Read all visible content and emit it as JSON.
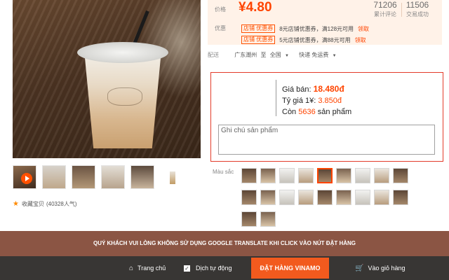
{
  "gallery": {
    "favorite_icon": "star-icon",
    "favorite_label": "收藏宝贝",
    "favorite_count": "(40328人气)"
  },
  "price_panel": {
    "price_label": "价格",
    "price": "¥4.80",
    "reviews_count": "71206",
    "reviews_label": "累计评论",
    "sales_count": "11506",
    "sales_label": "交易成功",
    "promo_label": "优惠",
    "coupons": [
      {
        "tag": "店铺 优惠券",
        "text": "8元店铺优惠券，满128元可用",
        "claim": "领取"
      },
      {
        "tag": "店铺 优惠券",
        "text": "5元店铺优惠券，满88元可用",
        "claim": "领取"
      }
    ]
  },
  "shipping": {
    "label": "配送",
    "from": "广东潮州",
    "to_word": "至",
    "to": "全国",
    "method": "快递 免运费"
  },
  "vn_info": {
    "price_label": "Giá bán:",
    "price_value": "18.480đ",
    "rate_label": "Tỷ giá 1¥:",
    "rate_value": "3.850đ",
    "stock_prefix": "Còn",
    "stock_value": "5636",
    "stock_suffix": "sản phẩm",
    "note_placeholder": "Ghi chú sản phẩm"
  },
  "colors": {
    "label": "Màu sắc",
    "selected_index": 4
  },
  "notice": {
    "text": "QUÝ KHÁCH VUI LÒNG KHÔNG SỬ DỤNG GOOGLE TRANSLATE KHI CLICK VÀO NÚT ĐẶT HÀNG"
  },
  "bottom_bar": {
    "home_label": "Trang chủ",
    "translate_label": "Dịch tự động",
    "translate_checked": true,
    "order_label": "ĐẶT HÀNG VINAMO",
    "cart_label": "Vào giỏ hàng"
  },
  "theme": {
    "accent": "#ff4400",
    "notice_bg": "#8b5544",
    "bar_bg": "#383634",
    "order_bg": "#f25a1e"
  }
}
